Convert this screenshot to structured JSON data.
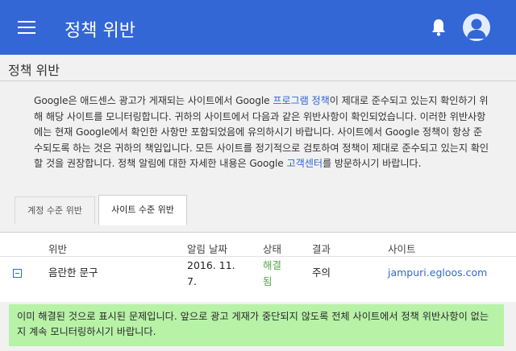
{
  "appbar": {
    "title": "정책 위반",
    "background": "#3367d6"
  },
  "page": {
    "title": "정책 위반",
    "intro_parts": {
      "p1": "Google은 애드센스 광고가 게재되는 사이트에서 Google ",
      "link1": "프로그램 정책",
      "p2": "이 제대로 준수되고 있는지 확인하기 위해 해당 사이트를 모니터링합니다. 귀하의 사이트에서 다음과 같은 위반사항이 확인되었습니다. 이러한 위반사항에는 현재 Google에서 확인한 사항만 포함되었음에 유의하시기 바랍니다. 사이트에서 Google 정책이 항상 준수되도록 하는 것은 귀하의 책임입니다. 모든 사이트를 정기적으로 검토하여 정책이 제대로 준수되고 있는지 확인할 것을 권장합니다. 정책 알림에 대한 자세한 내용은 Google ",
      "link2": "고객센터",
      "p3": "를 방문하시기 바랍니다."
    }
  },
  "tabs": [
    {
      "label": "계정 수준 위반",
      "active": false
    },
    {
      "label": "사이트 수준 위반",
      "active": true
    }
  ],
  "table": {
    "headers": {
      "violation": "위반",
      "date": "알림 날짜",
      "status": "상태",
      "result": "결과",
      "site": "사이트"
    },
    "rows": [
      {
        "violation": "음란한 문구",
        "date_line1": "2016. 11.",
        "date_line2": "7.",
        "status_line1": "해결",
        "status_line2": "됨",
        "result": "주의",
        "site": "jampuri.egloos.com"
      }
    ]
  },
  "notice": {
    "text": "이미 해결된 것으로 표시된 문제입니다. 앞으로 광고 게재가 중단되지 않도록 전체 사이트에서 정책 위반사항이 없는지 계속 모니터링하시기 바랍니다.",
    "background": "#b7f2a7"
  },
  "icons": {
    "menu": "menu-icon",
    "notifications": "bell-icon",
    "account": "avatar-icon",
    "collapse": "collapse-icon"
  }
}
